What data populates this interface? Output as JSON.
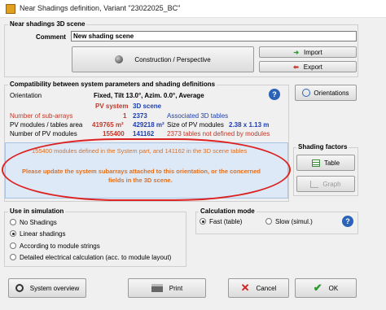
{
  "window": {
    "title": "Near Shadings definition, Variant \"23022025_BC\""
  },
  "scene": {
    "group_label": "Near shadings 3D scene",
    "comment_label": "Comment",
    "comment_value": "New shading scene",
    "construction_btn": "Construction / Perspective",
    "import_btn": "Import",
    "export_btn": "Export"
  },
  "compat": {
    "group_label": "Compatibility between system parameters and shading definitions",
    "orientation_label": "Orientation",
    "orientation_value": "Fixed, Tilt 13.0°, Azim. 0.0°, Average",
    "orientations_btn": "Orientations",
    "col_pv": "PV system",
    "col_3d": "3D scene",
    "row1_label": "Number of sub-arrays",
    "row1_pv": "1",
    "row1_3d": "2373",
    "row1_note": "Associated 3D tables",
    "row2_label": "PV modules / tables area",
    "row2_pv": "419765 m²",
    "row2_3d": "429218 m²",
    "row2_note": "Size of PV modules",
    "row2_size": "2.38 x 1.13 m",
    "row3_label": "Number of PV modules",
    "row3_pv": "155400",
    "row3_3d": "141162",
    "row3_note": "2373 tables not defined by modules"
  },
  "warning": {
    "line1": "155400 modules defined in the System part, and 141162 in the 3D scene tables",
    "line2": "Please update the system subarrays attached to this orientation, or the concerned",
    "line3": "fields in the 3D scene."
  },
  "shading_factors": {
    "label": "Shading factors",
    "table_btn": "Table",
    "graph_btn": "Graph"
  },
  "use": {
    "label": "Use in simulation",
    "options": [
      "No Shadings",
      "Linear shadings",
      "According to module strings",
      "Detailed electrical calculation (acc. to module layout)"
    ]
  },
  "calc": {
    "label": "Calculation mode",
    "fast": "Fast (table)",
    "slow": "Slow (simul.)"
  },
  "footer": {
    "overview_btn": "System overview",
    "print_btn": "Print",
    "cancel_btn": "Cancel",
    "ok_btn": "OK"
  },
  "colors": {
    "red": "#c0392b",
    "blue": "#1f3fb0",
    "orange": "#e07020",
    "accent": "#2a63b8"
  }
}
